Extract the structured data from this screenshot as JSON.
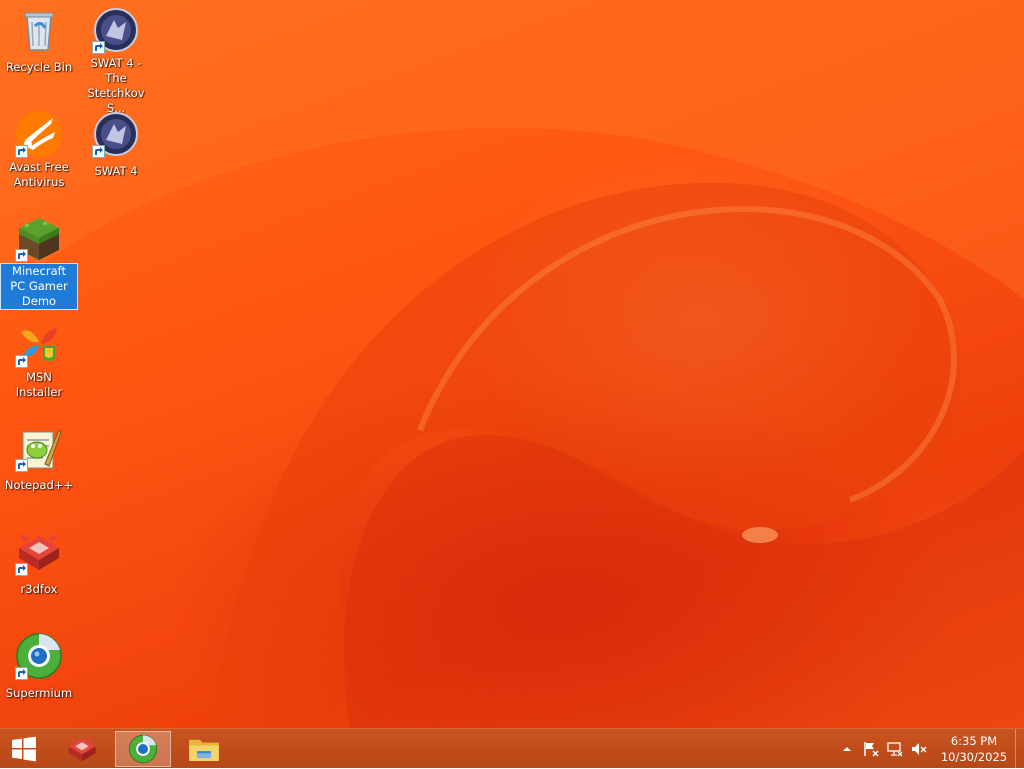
{
  "desktop": {
    "icons": [
      {
        "label": "Recycle Bin",
        "icon": "recycle-bin-icon",
        "shortcut": false
      },
      {
        "label": "SWAT 4 - The Stetchkov S...",
        "icon": "swat4-icon",
        "shortcut": true
      },
      {
        "label": "Avast Free Antivirus",
        "icon": "avast-icon",
        "shortcut": true
      },
      {
        "label": "SWAT 4",
        "icon": "swat4-icon",
        "shortcut": true
      },
      {
        "label": "Minecraft PC Gamer Demo",
        "icon": "minecraft-icon",
        "shortcut": true,
        "selected": true
      },
      {
        "label": "MSN Installer",
        "icon": "msn-icon",
        "shortcut": true
      },
      {
        "label": "Notepad++",
        "icon": "notepadpp-icon",
        "shortcut": true
      },
      {
        "label": "r3dfox",
        "icon": "r3dfox-icon",
        "shortcut": true
      },
      {
        "label": "Supermium",
        "icon": "supermium-icon",
        "shortcut": true
      }
    ]
  },
  "taskbar": {
    "start_icon": "windows-logo-icon",
    "pinned": [
      {
        "name": "r3dfox",
        "icon": "r3dfox-icon",
        "active": false
      },
      {
        "name": "Supermium",
        "icon": "supermium-icon",
        "active": true
      },
      {
        "name": "File Explorer",
        "icon": "folder-icon",
        "active": false
      }
    ],
    "tray": {
      "icons": [
        "chevron-up-icon",
        "action-center-flag-icon",
        "network-icon",
        "volume-muted-icon"
      ],
      "time": "6:35 PM",
      "date": "10/30/2025"
    }
  },
  "colors": {
    "wallpaper": "#ff5a16",
    "taskbar": "#c0501c",
    "selection": "#1e7cd8"
  }
}
